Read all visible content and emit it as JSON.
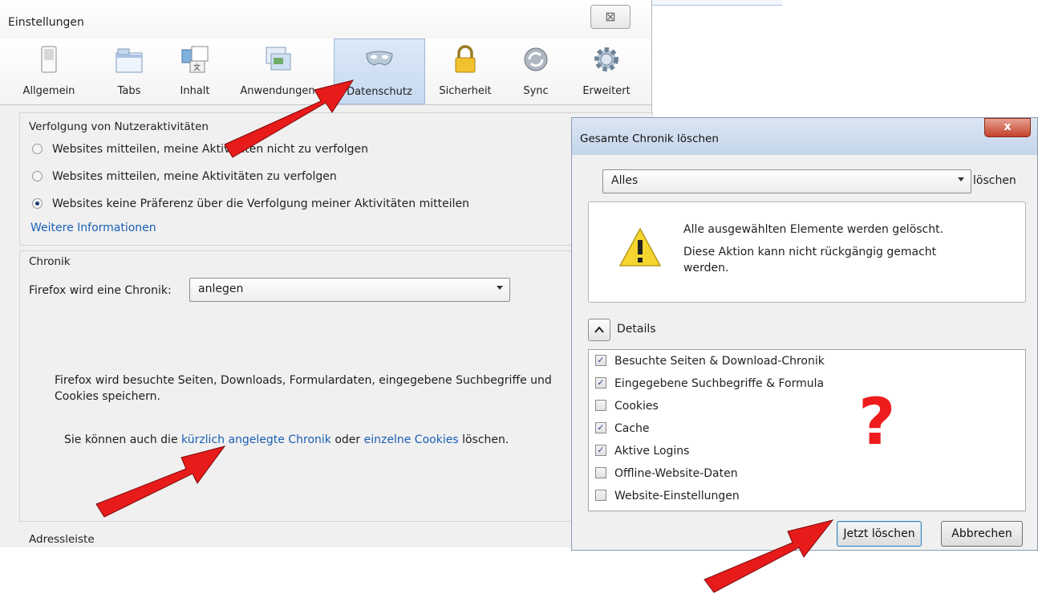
{
  "settings": {
    "title": "Einstellungen",
    "close_glyph": "⊠",
    "tabs": [
      {
        "label": "Allgemein",
        "icon": "switch-icon"
      },
      {
        "label": "Tabs",
        "icon": "tabs-icon"
      },
      {
        "label": "Inhalt",
        "icon": "content-icon"
      },
      {
        "label": "Anwendungen",
        "icon": "applications-icon"
      },
      {
        "label": "Datenschutz",
        "icon": "mask-icon"
      },
      {
        "label": "Sicherheit",
        "icon": "padlock-icon"
      },
      {
        "label": "Sync",
        "icon": "sync-icon"
      },
      {
        "label": "Erweitert",
        "icon": "gear-icon"
      }
    ],
    "tracking": {
      "title": "Verfolgung von Nutzeraktivitäten",
      "options": [
        "Websites mitteilen, meine Aktivitäten nicht zu verfolgen",
        "Websites mitteilen, meine Aktivitäten zu verfolgen",
        "Websites keine Präferenz über die Verfolgung meiner Aktivitäten mitteilen"
      ],
      "selected_index": 2,
      "more_info": "Weitere Informationen"
    },
    "history": {
      "title": "Chronik",
      "label": "Firefox wird eine Chronik:",
      "value": "anlegen",
      "desc_line1": "Firefox wird besuchte Seiten, Downloads, Formulardaten, eingegebene Suchbegriffe und",
      "desc_line2": "Cookies speichern.",
      "clear_prefix": "Sie können auch die",
      "clear_link1": "kürzlich angelegte Chronik",
      "clear_mid": "oder",
      "clear_link2": "einzelne Cookies",
      "clear_suffix": "löschen."
    },
    "addressbar": {
      "title": "Adressleiste"
    }
  },
  "dialog": {
    "title": "Gesamte Chronik löschen",
    "close_glyph": "x",
    "range_value": "Alles",
    "range_suffix": "löschen",
    "warning_line1": "Alle ausgewählten Elemente werden gelöscht.",
    "warning_line2": "Diese Aktion kann nicht rückgängig gemacht",
    "warning_line3": "werden.",
    "details_label": "Details",
    "items": [
      {
        "label": "Besuchte Seiten & Download-Chronik",
        "checked": true
      },
      {
        "label": "Eingegebene Suchbegriffe & Formula",
        "checked": true
      },
      {
        "label": "Cookies",
        "checked": false
      },
      {
        "label": "Cache",
        "checked": true
      },
      {
        "label": "Aktive Logins",
        "checked": true
      },
      {
        "label": "Offline-Website-Daten",
        "checked": false
      },
      {
        "label": "Website-Einstellungen",
        "checked": false
      }
    ],
    "primary_button": "Jetzt löschen",
    "cancel_button": "Abbrechen"
  },
  "annotation": {
    "question_mark": "?",
    "arrow_color": "#e81b1b"
  }
}
